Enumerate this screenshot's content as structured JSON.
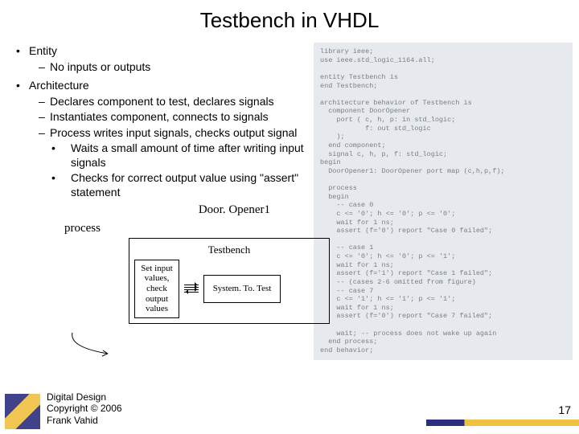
{
  "title": "Testbench in VHDL",
  "bullets": {
    "entity": "Entity",
    "entity_sub": "No inputs or outputs",
    "arch": "Architecture",
    "arch_sub1": "Declares component to test, declares signals",
    "arch_sub2": "Instantiates component, connects to signals",
    "arch_sub3": "Process writes input signals, checks output signal",
    "proc_sub1": "Waits a small amount of time after writing input signals",
    "proc_sub2": "Checks for correct output value using \"assert\" statement"
  },
  "diagram": {
    "instance": "Door. Opener1",
    "process": "process",
    "testbench": "Testbench",
    "box1_l1": "Set input",
    "box1_l2": "values,",
    "box1_l3": "check",
    "box1_l4": "output",
    "box1_l5": "values",
    "box2": "System. To. Test"
  },
  "code": "library ieee;\nuse ieee.std_logic_1164.all;\n\nentity Testbench is\nend Testbench;\n\narchitecture behavior of Testbench is\n  component DoorOpener\n    port ( c, h, p: in std_logic;\n           f: out std_logic\n    );\n  end component;\n  signal c, h, p, f: std_logic;\nbegin\n  DoorOpener1: DoorOpener port map (c,h,p,f);\n\n  process\n  begin\n    -- case 0\n    c <= '0'; h <= '0'; p <= '0';\n    wait for 1 ns;\n    assert (f='0') report \"Case 0 failed\";\n\n    -- case 1\n    c <= '0'; h <= '0'; p <= '1';\n    wait for 1 ns;\n    assert (f='1') report \"Case 1 failed\";\n    -- (cases 2-6 omitted from figure)\n    -- case 7\n    c <= '1'; h <= '1'; p <= '1';\n    wait for 1 ns;\n    assert (f='0') report \"Case 7 failed\";\n\n    wait; -- process does not wake up again\n  end process;\nend behavior;",
  "footer": {
    "l1": "Digital Design",
    "l2": "Copyright © 2006",
    "l3": "Frank Vahid"
  },
  "slide_number": "17"
}
